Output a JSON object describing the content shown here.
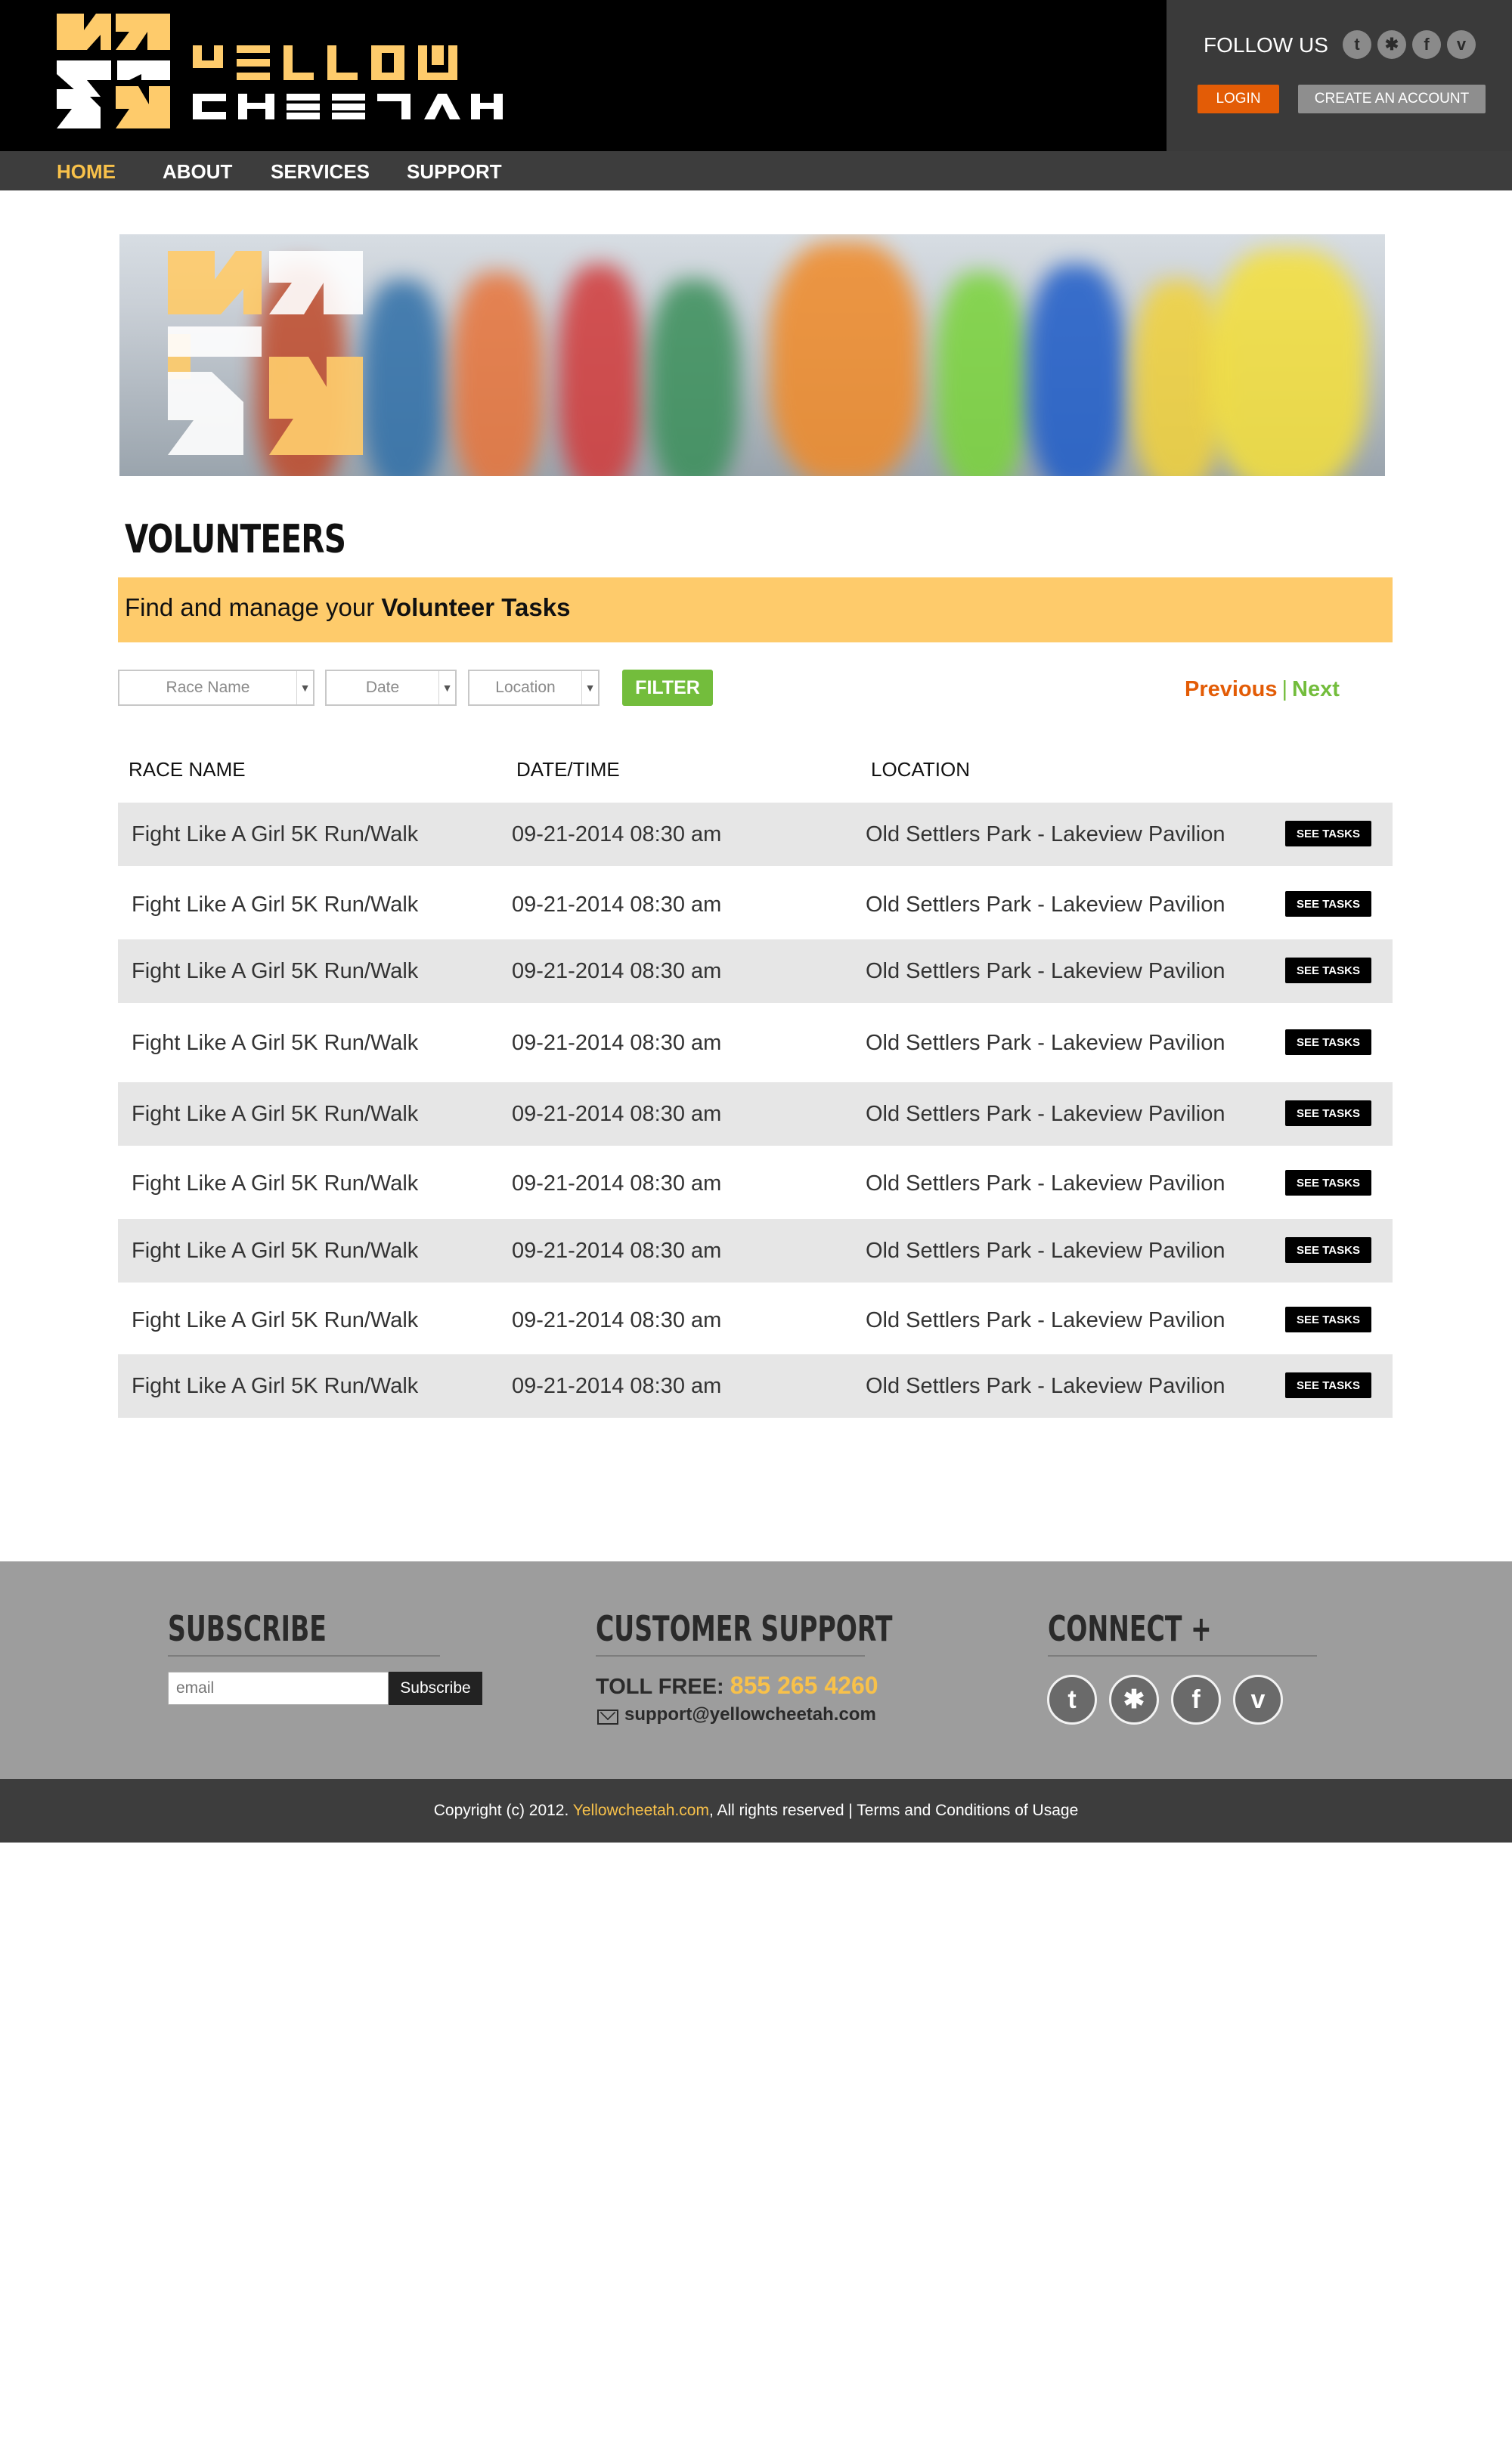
{
  "brand": {
    "word1": "YELLOW",
    "word2": "CHEETAH",
    "yellow": "#f8c14a",
    "orange": "#e35c06",
    "green": "#73bd3c"
  },
  "header": {
    "follow_label": "FOLLOW US",
    "social": [
      {
        "icon": "twitter-icon",
        "glyph": "t"
      },
      {
        "icon": "yelp-icon",
        "glyph": "✱"
      },
      {
        "icon": "facebook-icon",
        "glyph": "f"
      },
      {
        "icon": "vimeo-icon",
        "glyph": "v"
      }
    ],
    "login_label": "LOGIN",
    "create_label": "CREATE AN ACCOUNT"
  },
  "nav": {
    "items": [
      {
        "label": "HOME",
        "active": true
      },
      {
        "label": "ABOUT",
        "active": false
      },
      {
        "label": "SERVICES",
        "active": false
      },
      {
        "label": "SUPPORT",
        "active": false
      }
    ]
  },
  "page": {
    "title": "VOLUNTEERS",
    "banner_prefix": "Find and manage your ",
    "banner_bold": "Volunteer Tasks"
  },
  "filters": {
    "race_name_placeholder": "Race Name",
    "date_placeholder": "Date",
    "location_placeholder": "Location",
    "filter_label": "FILTER",
    "previous_label": "Previous",
    "separator": "|",
    "next_label": "Next"
  },
  "table": {
    "headers": [
      "RACE NAME",
      "DATE/TIME",
      "LOCATION"
    ],
    "button_label": "SEE TASKS",
    "rows": [
      {
        "race": "Fight Like A Girl 5K Run/Walk",
        "datetime": "09-21-2014 08:30 am",
        "location": "Old Settlers Park - Lakeview Pavilion"
      },
      {
        "race": "Fight Like A Girl 5K Run/Walk",
        "datetime": "09-21-2014 08:30 am",
        "location": "Old Settlers Park - Lakeview Pavilion"
      },
      {
        "race": "Fight Like A Girl 5K Run/Walk",
        "datetime": "09-21-2014 08:30 am",
        "location": "Old Settlers Park - Lakeview Pavilion"
      },
      {
        "race": "Fight Like A Girl 5K Run/Walk",
        "datetime": "09-21-2014 08:30 am",
        "location": "Old Settlers Park - Lakeview Pavilion"
      },
      {
        "race": "Fight Like A Girl 5K Run/Walk",
        "datetime": "09-21-2014 08:30 am",
        "location": "Old Settlers Park - Lakeview Pavilion"
      },
      {
        "race": "Fight Like A Girl 5K Run/Walk",
        "datetime": "09-21-2014 08:30 am",
        "location": "Old Settlers Park - Lakeview Pavilion"
      },
      {
        "race": "Fight Like A Girl 5K Run/Walk",
        "datetime": "09-21-2014 08:30 am",
        "location": "Old Settlers Park - Lakeview Pavilion"
      },
      {
        "race": "Fight Like A Girl 5K Run/Walk",
        "datetime": "09-21-2014 08:30 am",
        "location": "Old Settlers Park - Lakeview Pavilion"
      },
      {
        "race": "Fight Like A Girl 5K Run/Walk",
        "datetime": "09-21-2014 08:30 am",
        "location": "Old Settlers Park - Lakeview Pavilion"
      }
    ]
  },
  "footer": {
    "subscribe_heading": "SUBSCRIBE",
    "email_placeholder": "email",
    "subscribe_button": "Subscribe",
    "support_heading": "CUSTOMER SUPPORT",
    "toll_label": "TOLL FREE:",
    "toll_number": "855 265 4260",
    "support_email": "support@yellowcheetah.com",
    "connect_heading": "CONNECT +",
    "social": [
      {
        "icon": "twitter-icon",
        "glyph": "t"
      },
      {
        "icon": "yelp-icon",
        "glyph": "✱"
      },
      {
        "icon": "facebook-icon",
        "glyph": "f"
      },
      {
        "icon": "vimeo-icon",
        "glyph": "v"
      }
    ],
    "copyright_prefix": "Copyright (c) 2012. ",
    "copyright_brand": "Yellowcheetah.com",
    "copyright_suffix": ", All rights reserved | Terms and Conditions of Usage"
  }
}
